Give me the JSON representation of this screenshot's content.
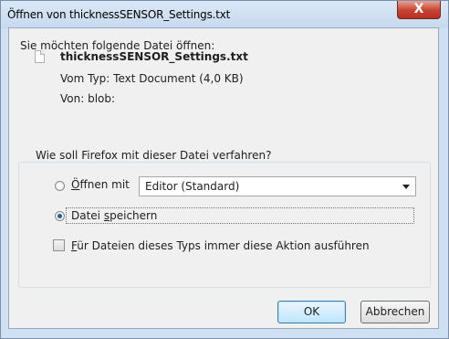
{
  "window": {
    "title": "Öffnen von thicknessSENSOR_Settings.txt",
    "close_label": "X"
  },
  "dialog": {
    "prompt": "Sie möchten folgende Datei öffnen:",
    "file_name": "thicknessSENSOR_Settings.txt",
    "type_line": "Vom Typ: Text Document (4,0 KB)",
    "from_line": "Von: blob:"
  },
  "action_group": {
    "legend": "Wie soll Firefox mit dieser Datei verfahren?",
    "open_with": {
      "accel": "Ö",
      "rest": "ffnen mit",
      "selected": false
    },
    "open_with_app": "Editor (Standard)",
    "save_file": {
      "before": "Datei ",
      "accel": "s",
      "after": "peichern",
      "selected": true
    },
    "remember": {
      "accel": "F",
      "rest": "ür Dateien dieses Typs immer diese Aktion ausführen",
      "checked": false
    }
  },
  "buttons": {
    "ok": "OK",
    "cancel": "Abbrechen"
  }
}
